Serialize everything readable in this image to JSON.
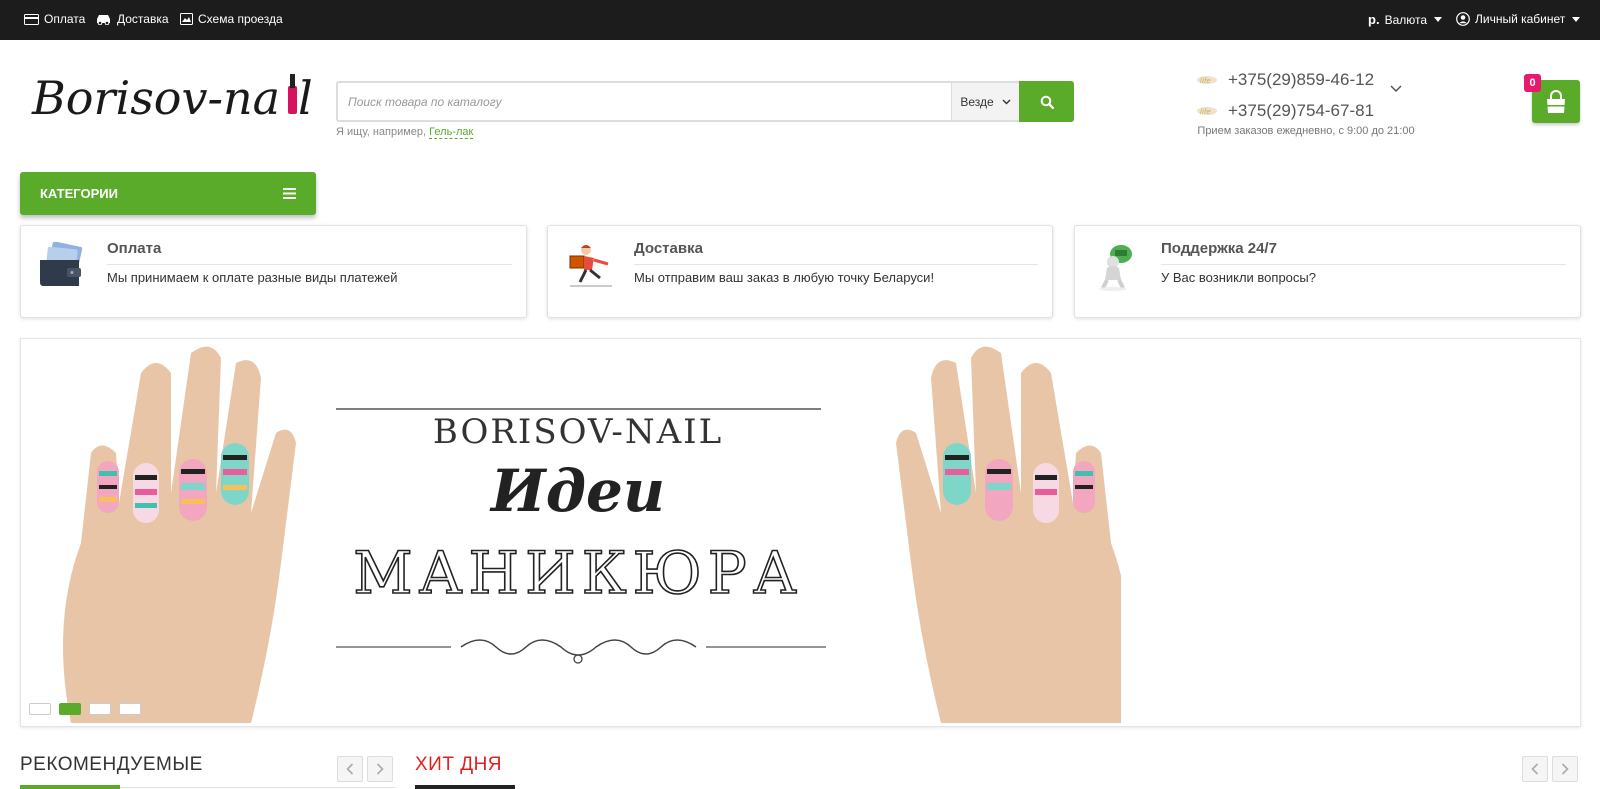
{
  "topbar": {
    "payment_label": "Оплата",
    "delivery_label": "Доставка",
    "map_label": "Схема проезда",
    "currency_symbol": "р.",
    "currency_label": "Валюта",
    "account_label": "Личный кабинет"
  },
  "header": {
    "logo_text": "Borisov-nail",
    "search": {
      "placeholder": "Поиск товара по каталогу",
      "value": "",
      "scope_label": "Везде",
      "hint_prefix": "Я ищу, например,",
      "hint_link": "Гель-лак"
    },
    "phones": [
      "+375(29)859-46-12",
      "+375(29)754-67-81"
    ],
    "hours": "Прием заказов ежедневно, с 9:00 до 21:00",
    "cart_count": "0"
  },
  "categories_label": "КАТЕГОРИИ",
  "features": [
    {
      "icon": "wallet-icon",
      "title": "Оплата",
      "text": "Мы принимаем к оплате разные виды платежей"
    },
    {
      "icon": "courier-icon",
      "title": "Доставка",
      "text": "Мы отправим ваш заказ в любую точку Беларуси!"
    },
    {
      "icon": "support-icon",
      "title": "Поддержка 24/7",
      "text": "У Вас возникли вопросы?"
    }
  ],
  "banner": {
    "brand": "BORISOV-NAIL",
    "line1": "Идеи",
    "line2": "МАНИКЮРА",
    "slides": 4,
    "active_slide": 2
  },
  "sections": {
    "recommended": "РЕКОМЕНДУЕМЫЕ",
    "hit": "ХИТ ДНЯ"
  },
  "colors": {
    "accent": "#5aab2a",
    "topbar": "#1c1c1c",
    "badge": "#e8186d",
    "hit_title": "#e02020"
  }
}
